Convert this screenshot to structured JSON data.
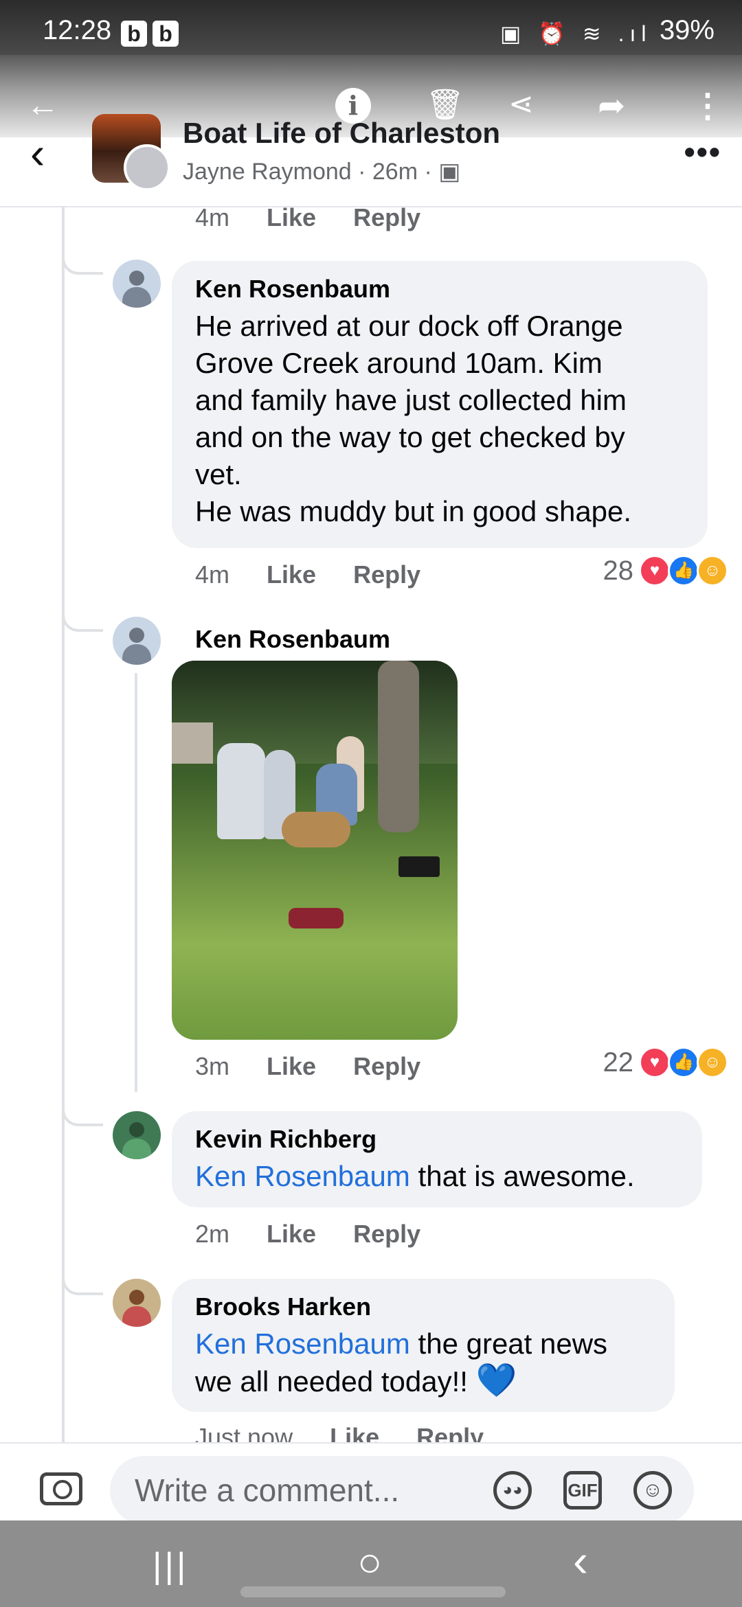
{
  "status_bar": {
    "time": "12:28",
    "notif_a": "b",
    "notif_b": "b",
    "battery": "39%",
    "sys_icons": "▣ ⏰ ≋ .ıl"
  },
  "viewer_bar": {
    "back_icon": "back-arrow-icon",
    "info": "i",
    "icons": [
      "info-icon",
      "trash-icon",
      "share-icon",
      "forward-icon",
      "kebab-icon"
    ]
  },
  "post_header": {
    "group_name": "Boat Life of Charleston",
    "meta": "Jayne Raymond · 26m · ▣"
  },
  "top_actions": {
    "time": "4m",
    "like": "Like",
    "reply": "Reply"
  },
  "comments": [
    {
      "author": "Ken Rosenbaum",
      "text": "He arrived at our dock off Orange\nGrove Creek around 10am. Kim\nand family have just collected him\nand on the way to get checked by\nvet.\nHe was muddy but in good shape.",
      "time": "4m",
      "like": "Like",
      "reply": "Reply",
      "reaction_count": "28"
    },
    {
      "author": "Ken Rosenbaum",
      "has_photo": true,
      "time": "3m",
      "like": "Like",
      "reply": "Reply",
      "reaction_count": "22"
    },
    {
      "author": "Kevin Richberg",
      "mention": "Ken Rosenbaum",
      "text": " that is awesome.",
      "time": "2m",
      "like": "Like",
      "reply": "Reply"
    },
    {
      "author": "Brooks Harken",
      "mention": "Ken Rosenbaum",
      "text_line1": " the great news",
      "text_line2": "we all needed today!! ",
      "emoji": "💙",
      "time": "Just now",
      "like": "Like",
      "reply": "Reply"
    }
  ],
  "composer": {
    "placeholder": "Write a comment...",
    "gif_label": "GIF"
  },
  "nav_bar": {
    "recents": "|||",
    "home": "○",
    "back": "‹"
  },
  "colors": {
    "mention": "#216fdb",
    "bubble": "#f0f2f5",
    "love": "#f33e58",
    "like": "#1877f2"
  }
}
